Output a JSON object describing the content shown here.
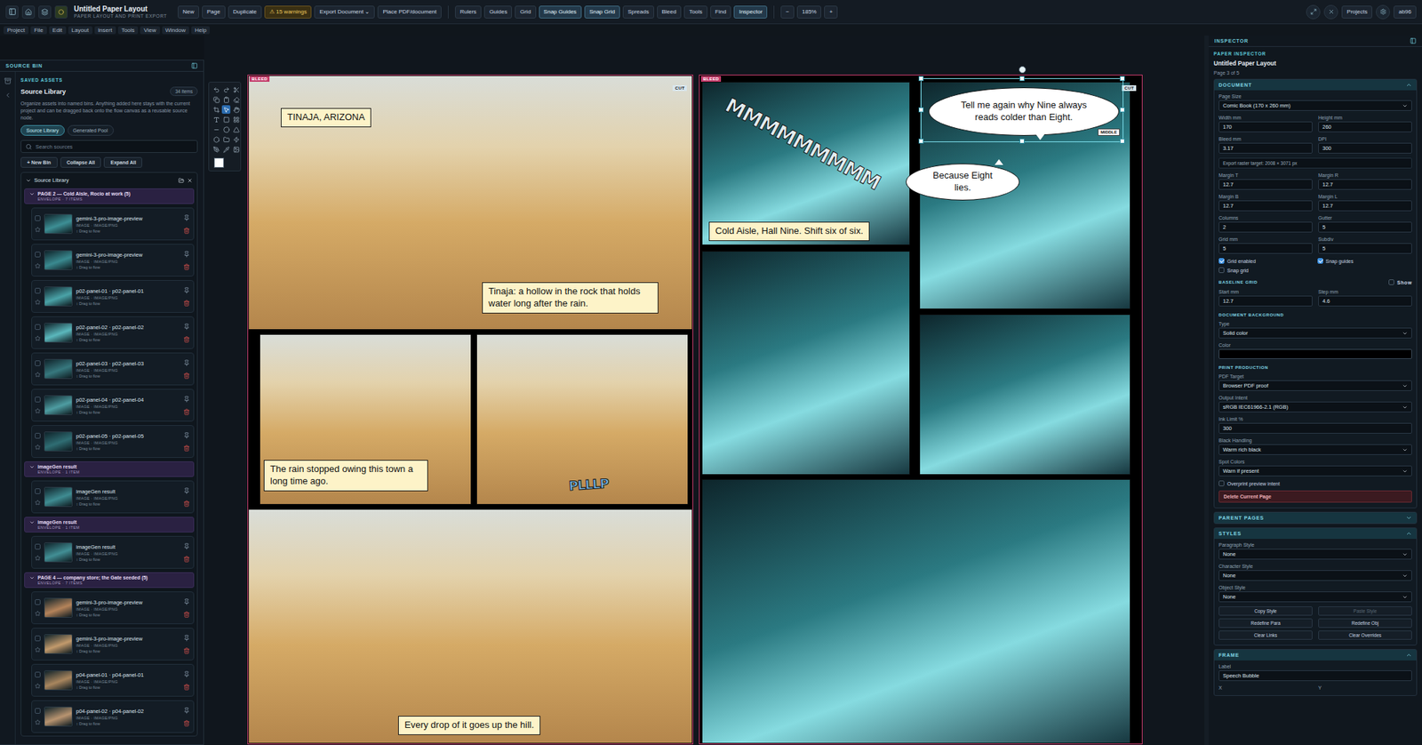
{
  "app": {
    "title": "Untitled Paper Layout",
    "subtitle": "PAPER LAYOUT AND PRINT EXPORT"
  },
  "toolbar_groups": [
    [
      {
        "label": "New",
        "kind": "plain",
        "active": false
      },
      {
        "label": "Page",
        "kind": "plain",
        "active": false
      },
      {
        "label": "Duplicate",
        "kind": "plain",
        "active": false
      },
      {
        "label": "⚠ 15 warnings",
        "kind": "warning",
        "active": false
      },
      {
        "label": "Export Document ⌄",
        "kind": "plain",
        "active": false
      },
      {
        "label": "Place PDF/document",
        "kind": "plain",
        "active": false
      }
    ],
    [
      {
        "label": "Rulers",
        "kind": "plain",
        "active": false
      },
      {
        "label": "Guides",
        "kind": "plain",
        "active": false
      },
      {
        "label": "Grid",
        "kind": "plain",
        "active": false
      },
      {
        "label": "Snap Guides",
        "kind": "plain",
        "active": true
      },
      {
        "label": "Snap Grid",
        "kind": "plain",
        "active": true
      },
      {
        "label": "Spreads",
        "kind": "plain",
        "active": false
      },
      {
        "label": "Bleed",
        "kind": "plain",
        "active": false
      },
      {
        "label": "Tools",
        "kind": "plain",
        "active": false
      },
      {
        "label": "Find",
        "kind": "plain",
        "active": false
      },
      {
        "label": "Inspector",
        "kind": "plain",
        "active": true
      }
    ]
  ],
  "zoom": {
    "out": "−",
    "value": "185%",
    "in": "+"
  },
  "top_right": [
    "Projects",
    "ab96"
  ],
  "menu": [
    "Project",
    "File",
    "Edit",
    "Layout",
    "Insert",
    "Tools",
    "View",
    "Window",
    "Help"
  ],
  "source_bin": {
    "header": "SOURCE BIN",
    "eyebrow": "SAVED ASSETS",
    "title": "Source Library",
    "count": "34 items",
    "description": "Organize assets into named bins. Anything added here stays with the current project and can be dragged back onto the flow canvas as a reusable source node.",
    "tabs": [
      {
        "label": "Source Library",
        "selected": true
      },
      {
        "label": "Generated Pool",
        "selected": false
      }
    ],
    "search_placeholder": "Search sources",
    "actions": [
      "+ New Bin",
      "Collapse All",
      "Expand All"
    ],
    "tree_title": "Source Library",
    "bins": [
      {
        "title": "PAGE 2 — Cold Aisle, Rocio at work (5)",
        "meta": "ENVELOPE · 7 ITEMS",
        "expanded": true,
        "items": [
          {
            "name": "gemini-3-pro-image-preview",
            "type": "IMAGE · IMAGE/PNG",
            "hint": "↕ Drag to flow",
            "color": "#3d8f95"
          },
          {
            "name": "gemini-3-pro-image-preview",
            "type": "IMAGE · IMAGE/PNG",
            "hint": "↕ Drag to flow",
            "color": "#3a8a90"
          },
          {
            "name": "p02-panel-01 · p02-panel-01",
            "type": "IMAGE · IMAGE/PNG",
            "hint": "↕ Drag to flow",
            "color": "#4aa3a8"
          },
          {
            "name": "p02-panel-02 · p02-panel-02",
            "type": "IMAGE · IMAGE/PNG",
            "hint": "↕ Drag to flow",
            "color": "#5bb8bd"
          },
          {
            "name": "p02-panel-03 · p02-panel-03",
            "type": "IMAGE · IMAGE/PNG",
            "hint": "↕ Drag to flow",
            "color": "#37787e"
          },
          {
            "name": "p02-panel-04 · p02-panel-04",
            "type": "IMAGE · IMAGE/PNG",
            "hint": "↕ Drag to flow",
            "color": "#4e9da2"
          },
          {
            "name": "p02-panel-05 · p02-panel-05",
            "type": "IMAGE · IMAGE/PNG",
            "hint": "↕ Drag to flow",
            "color": "#2f6d73"
          }
        ]
      },
      {
        "title": "imageGen result",
        "meta": "ENVELOPE · 1 ITEM",
        "expanded": true,
        "items": [
          {
            "name": "imageGen result",
            "type": "IMAGE · IMAGE/PNG",
            "hint": "↕ Drag to flow",
            "color": "#3f8c92"
          }
        ]
      },
      {
        "title": "imageGen result",
        "meta": "ENVELOPE · 1 ITEM",
        "expanded": true,
        "items": [
          {
            "name": "imageGen result",
            "type": "IMAGE · IMAGE/PNG",
            "hint": "↕ Drag to flow",
            "color": "#428f95"
          }
        ]
      },
      {
        "title": "PAGE 4 — company store; the Gate seeded (5)",
        "meta": "ENVELOPE · 7 ITEMS",
        "expanded": true,
        "items": [
          {
            "name": "gemini-3-pro-image-preview",
            "type": "IMAGE · IMAGE/PNG",
            "hint": "↕ Drag to flow",
            "color": "#b4835a"
          },
          {
            "name": "gemini-3-pro-image-preview",
            "type": "IMAGE · IMAGE/PNG",
            "hint": "↕ Drag to flow",
            "color": "#c29a6c"
          },
          {
            "name": "p04-panel-01 · p04-panel-01",
            "type": "IMAGE · IMAGE/PNG",
            "hint": "↕ Drag to flow",
            "color": "#a9865e"
          },
          {
            "name": "p04-panel-02 · p04-panel-02",
            "type": "IMAGE · IMAGE/PNG",
            "hint": "↕ Drag to flow",
            "color": "#b89470"
          }
        ]
      }
    ]
  },
  "tools": [
    {
      "selected": false
    },
    {
      "selected": false
    },
    {
      "selected": false
    },
    {
      "selected": false
    },
    {
      "selected": false
    },
    {
      "selected": false
    },
    {
      "selected": false
    },
    {
      "selected": true
    },
    {
      "selected": false
    },
    {
      "selected": false
    },
    {
      "selected": false
    },
    {
      "selected": false
    },
    {
      "selected": false
    },
    {
      "selected": false
    },
    {
      "selected": false
    },
    {
      "selected": false
    },
    {
      "selected": false
    },
    {
      "selected": false
    },
    {
      "selected": false
    },
    {
      "selected": false
    },
    {
      "selected": false
    }
  ],
  "left_page": {
    "bleed": "BLEED",
    "cut": "CUT",
    "top": {
      "kind": "desert",
      "captions": [
        "TINAJA, ARIZONA",
        "Tinaja: a hollow in the rock that holds water long after the rain."
      ]
    },
    "middle": [
      {
        "kind": "desert",
        "caption": "The rain stopped owing this town a long time ago."
      },
      {
        "kind": "desert",
        "sfx": "PLLLP"
      }
    ],
    "bottom": {
      "kind": "desert",
      "caption": "Every drop of it goes up the hill."
    }
  },
  "right_page": {
    "bleed": "BLEED",
    "cut": "CUT",
    "panels": [
      {
        "kind": "lab",
        "sfx": "MMMMMMMMM",
        "caption": "Cold Aisle, Hall Nine. Shift six of six."
      },
      {
        "kind": "lab"
      },
      {
        "kind": "lab"
      },
      {
        "kind": "lab"
      },
      {
        "kind": "lab"
      }
    ],
    "bubbles": [
      {
        "text": "Tell me again why Nine always reads colder than Eight.",
        "selected": true,
        "tag": "MIDDLE"
      },
      {
        "text": "Because Eight lies.",
        "selected": false,
        "tag": ""
      }
    ]
  },
  "inspector": {
    "header": "INSPECTOR",
    "eyebrow": "PAPER INSPECTOR",
    "title": "Untitled Paper Layout",
    "page": "Page 3 of 5",
    "document": {
      "title": "DOCUMENT",
      "expanded": true,
      "page_size": {
        "label": "Page Size",
        "value": "Comic Book (170 x 260 mm)"
      },
      "pairs": [
        [
          {
            "label": "Width mm",
            "value": "170"
          },
          {
            "label": "Height mm",
            "value": "260"
          }
        ],
        [
          {
            "label": "Bleed mm",
            "value": "3.17"
          },
          {
            "label": "DPI",
            "value": "300"
          }
        ]
      ],
      "export_target": "Export raster target: 2008 × 3071 px",
      "pairs2": [
        [
          {
            "label": "Margin T",
            "value": "12.7"
          },
          {
            "label": "Margin R",
            "value": "12.7"
          }
        ],
        [
          {
            "label": "Margin B",
            "value": "12.7"
          },
          {
            "label": "Margin L",
            "value": "12.7"
          }
        ],
        [
          {
            "label": "Columns",
            "value": "2"
          },
          {
            "label": "Gutter",
            "value": "5"
          }
        ],
        [
          {
            "label": "Grid mm",
            "value": "5"
          },
          {
            "label": "Subdiv",
            "value": "5"
          }
        ]
      ],
      "checks": [
        {
          "label": "Grid enabled",
          "checked": true
        },
        {
          "label": "Snap guides",
          "checked": true
        },
        {
          "label": "Snap grid",
          "checked": false
        }
      ],
      "baseline": {
        "title": "BASELINE GRID",
        "show": {
          "label": "Show",
          "checked": false
        },
        "fields": [
          {
            "label": "Start mm",
            "value": "12.7"
          },
          {
            "label": "Step mm",
            "value": "4.6"
          }
        ]
      },
      "background": {
        "title": "DOCUMENT BACKGROUND",
        "type": {
          "label": "Type",
          "value": "Solid color"
        },
        "color": {
          "label": "Color",
          "value": "#000000"
        }
      },
      "print": {
        "title": "PRINT PRODUCTION",
        "fields": [
          {
            "label": "PDF Target",
            "value": "Browser PDF proof",
            "kind": "select"
          },
          {
            "label": "Output Intent",
            "value": "sRGB IEC61966-2.1 (RGB)",
            "kind": "select"
          },
          {
            "label": "Ink Limit %",
            "value": "300",
            "kind": "input"
          },
          {
            "label": "Black Handling",
            "value": "Warm rich black",
            "kind": "select"
          },
          {
            "label": "Spot Colors",
            "value": "Warn if present",
            "kind": "select"
          }
        ],
        "overprint": {
          "label": "Overprint preview intent",
          "checked": false
        }
      },
      "delete": "Delete Current Page"
    },
    "parent_pages": {
      "title": "PARENT PAGES",
      "expanded": false
    },
    "styles": {
      "title": "STYLES",
      "expanded": true,
      "selects": [
        {
          "label": "Paragraph Style",
          "value": "None"
        },
        {
          "label": "Character Style",
          "value": "None"
        },
        {
          "label": "Object Style",
          "value": "None"
        }
      ],
      "buttons": [
        {
          "label": "Copy Style",
          "disabled": false
        },
        {
          "label": "Paste Style",
          "disabled": true
        },
        {
          "label": "Redefine Para",
          "disabled": false
        },
        {
          "label": "Redefine Obj",
          "disabled": false
        },
        {
          "label": "Clear Links",
          "disabled": false
        },
        {
          "label": "Clear Overrides",
          "disabled": false
        }
      ]
    },
    "frame": {
      "title": "FRAME",
      "expanded": true,
      "label": {
        "label": "Label",
        "value": "Speech Bubble"
      },
      "coords": [
        "X",
        "Y"
      ]
    }
  }
}
